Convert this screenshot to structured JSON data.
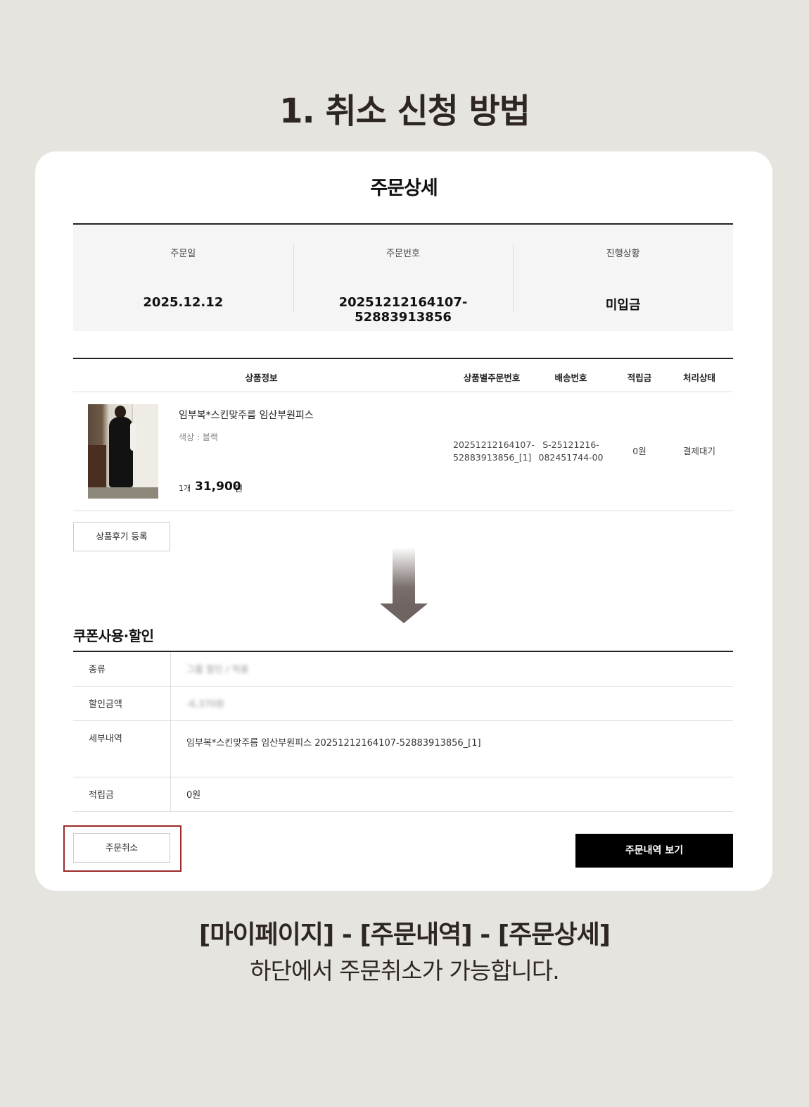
{
  "heading": "1. 취소 신청 방법",
  "order_detail": {
    "title": "주문상세",
    "summary": [
      {
        "label": "주문일",
        "value": "2025.12.12"
      },
      {
        "label": "주문번호",
        "value": "20251212164107-52883913856"
      },
      {
        "label": "진행상황",
        "value": "미입금"
      }
    ],
    "items_header": {
      "product_info": "상품정보",
      "item_order_no": "상품별주문번호",
      "shipping_no": "배송번호",
      "points": "적립금",
      "status": "처리상태"
    },
    "item": {
      "name": "임부복*스킨맞주름 임산부원피스",
      "option": "색상 : 블랙",
      "qty": "1개",
      "price": "31,900",
      "price_unit": "원",
      "order_no_line1": "20251212164107-",
      "order_no_line2": "52883913856_[1]",
      "shipping_no_line1": "S-25121216-",
      "shipping_no_line2": "082451744-00",
      "points": "0원",
      "status": "결제대기"
    },
    "review_button": "상품후기 등록",
    "coupon": {
      "title": "쿠폰사용·할인",
      "rows": [
        {
          "label": "종류",
          "value": "그룹 할인 / 적용"
        },
        {
          "label": "할인금액",
          "value": "-6,370원"
        },
        {
          "label": "세부내역",
          "value": "임부복*스킨맞주름 임산부원피스 20251212164107-52883913856_[1]"
        },
        {
          "label": "적립금",
          "value": "0원"
        }
      ]
    },
    "cancel_button": "주문취소",
    "history_button": "주문내역 보기"
  },
  "caption": {
    "line1": "[마이페이지] - [주문내역] - [주문상세]",
    "line2": "하단에서 주문취소가 가능합니다."
  },
  "colors": {
    "background": "#e6e4df",
    "highlight_border": "#9b2a2a",
    "primary_button": "#000000"
  }
}
